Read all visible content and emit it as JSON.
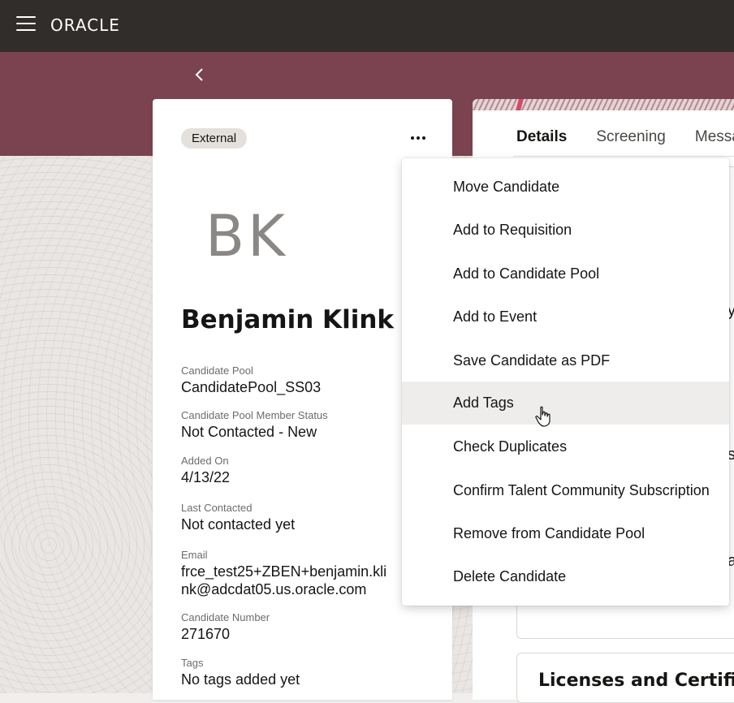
{
  "header": {
    "logo_text": "ORACLE",
    "menu_icon": "hamburger-menu-icon"
  },
  "nav": {
    "back_icon": "chevron-left-icon"
  },
  "candidate": {
    "badge": "External",
    "initials": "BK",
    "name": "Benjamin Klink",
    "fields": [
      {
        "label": "Candidate Pool",
        "value": "CandidatePool_SS03"
      },
      {
        "label": "Candidate Pool Member Status",
        "value": "Not Contacted - New"
      },
      {
        "label": "Added On",
        "value": "4/13/22"
      },
      {
        "label": "Last Contacted",
        "value": "Not contacted yet"
      },
      {
        "label": "Email",
        "value_line1": "frce_test25+ZBEN+benjamin.kli",
        "value_line2": "nk@adcdat05.us.oracle.com"
      },
      {
        "label": "Candidate Number",
        "value": "271670"
      },
      {
        "label": "Tags",
        "value": "No tags added yet"
      }
    ]
  },
  "tabs": [
    {
      "label": "Details",
      "active": true
    },
    {
      "label": "Screening",
      "active": false
    },
    {
      "label": "Messag",
      "active": false
    }
  ],
  "right_panel": {
    "fragment_1": "y",
    "fragment_2": "s",
    "fragment_3": "a",
    "section_title": "Licenses and Certificat"
  },
  "actions_menu": {
    "items": [
      "Move Candidate",
      "Add to Requisition",
      "Add to Candidate Pool",
      "Add to Event",
      "Save Candidate as PDF",
      "Add Tags",
      "Check Duplicates",
      "Confirm Talent Community Subscription",
      "Remove from Candidate Pool",
      "Delete Candidate"
    ],
    "hovered_index": 5
  },
  "colors": {
    "topbar": "#312d2a",
    "banner": "#7a434f",
    "hover": "#efedeb"
  }
}
